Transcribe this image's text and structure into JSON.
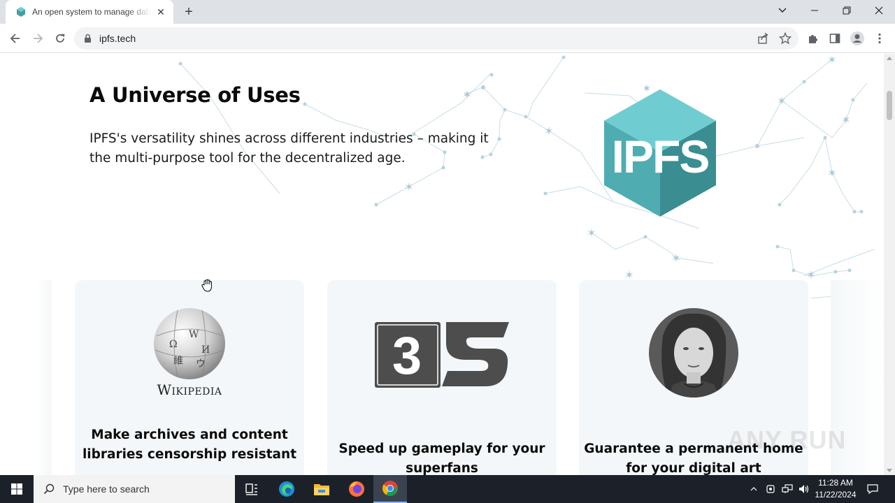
{
  "browser": {
    "tab_title": "An open system to manage data without a central server",
    "url": "ipfs.tech"
  },
  "page": {
    "heading": "A Universe of Uses",
    "lede": "IPFS's versatility shines across different industries – making it the multi-purpose tool for the decentralized age.",
    "logo_text": "IPFS",
    "cards": [
      {
        "logo": "Wikipedia",
        "title": "Make archives and content libraries censorship resistant"
      },
      {
        "logo": "3S",
        "title": "Speed up gameplay for your superfans"
      },
      {
        "logo": "portrait",
        "title": "Guarantee a permanent home for your digital art"
      }
    ],
    "watermark": "ANY RUN"
  },
  "taskbar": {
    "search_placeholder": "Type here to search",
    "time": "11:28 AM",
    "date": "11/22/2024"
  },
  "colors": {
    "ipfs_teal_light": "#6fcdd1",
    "ipfs_teal": "#469ea2",
    "ipfs_teal_dark": "#2d7d80",
    "card_bg": "#f4f7f9",
    "constellation": "#c5dbe4"
  }
}
